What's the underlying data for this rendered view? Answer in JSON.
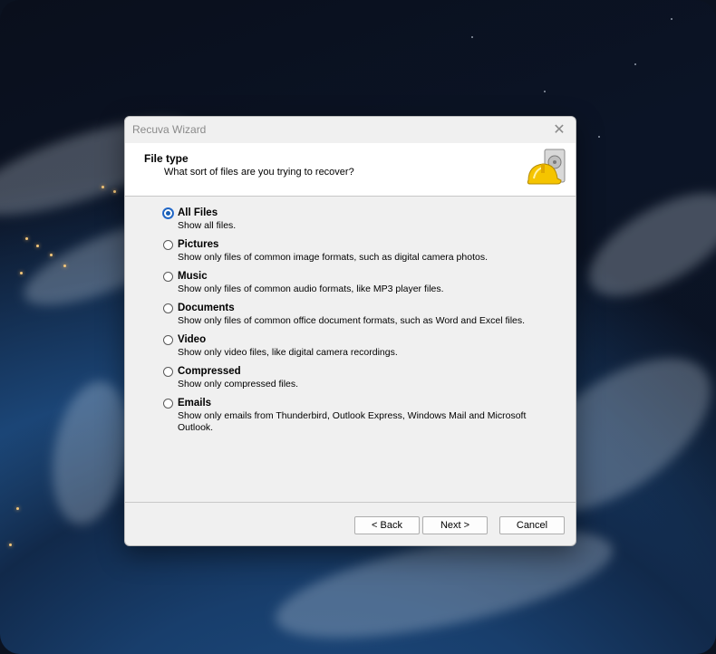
{
  "window": {
    "title": "Recuva Wizard",
    "close_glyph": "✕"
  },
  "header": {
    "title": "File type",
    "subtitle": "What sort of files are you trying to recover?",
    "logo_icon": "recuva-hardhat-drive-icon"
  },
  "options": [
    {
      "label": "All Files",
      "desc": "Show all files.",
      "checked": true
    },
    {
      "label": "Pictures",
      "desc": "Show only files of common image formats, such as digital camera photos.",
      "checked": false
    },
    {
      "label": "Music",
      "desc": "Show only files of common audio formats, like MP3 player files.",
      "checked": false
    },
    {
      "label": "Documents",
      "desc": "Show only files of common office document formats, such as Word and Excel files.",
      "checked": false
    },
    {
      "label": "Video",
      "desc": "Show only video files, like digital camera recordings.",
      "checked": false
    },
    {
      "label": "Compressed",
      "desc": "Show only compressed files.",
      "checked": false
    },
    {
      "label": "Emails",
      "desc": "Show only emails from Thunderbird, Outlook Express, Windows Mail and Microsoft Outlook.",
      "checked": false
    }
  ],
  "buttons": {
    "back": "< Back",
    "next": "Next >",
    "cancel": "Cancel"
  },
  "colors": {
    "accent": "#1a5fb4",
    "dialog_bg": "#f0f0f0",
    "header_bg": "#ffffff"
  }
}
